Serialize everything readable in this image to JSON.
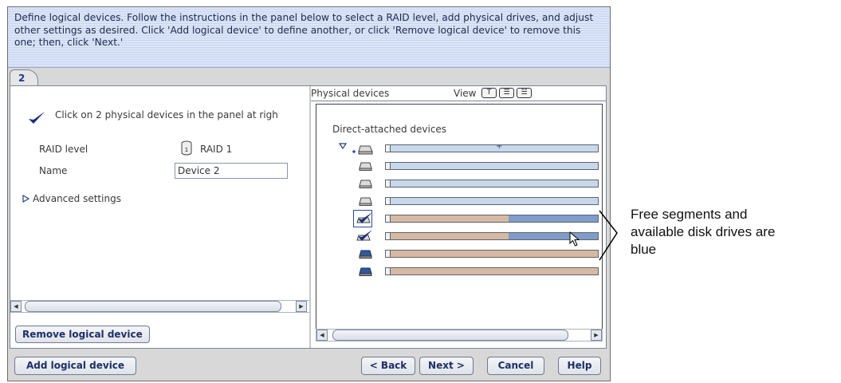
{
  "instructions": "Define logical devices.  Follow the instructions in the panel below to select a RAID level, add physical drives, and adjust other settings as desired.  Click 'Add logical device' to define another, or click 'Remove logical device' to remove this one; then, click 'Next.'",
  "tab": {
    "label": "2"
  },
  "left": {
    "instruction": "Click on 2 physical devices in the panel at righ",
    "raid_label": "RAID level",
    "raid_value": "RAID 1",
    "name_label": "Name",
    "name_value": "Device 2",
    "advanced": "Advanced settings"
  },
  "right": {
    "title": "Physical devices",
    "view_label": "View",
    "view_buttons": [
      "T",
      "list",
      "list-alt"
    ],
    "section_label": "Direct-attached devices"
  },
  "devices": [
    {
      "state": "expanded-free",
      "free_fraction": 1.0
    },
    {
      "state": "free",
      "free_fraction": 1.0
    },
    {
      "state": "free",
      "free_fraction": 1.0
    },
    {
      "state": "free",
      "free_fraction": 1.0
    },
    {
      "state": "selected",
      "used_fraction": 0.58,
      "free_fraction": 0.42
    },
    {
      "state": "selected",
      "used_fraction": 0.58,
      "free_fraction": 0.42
    },
    {
      "state": "used",
      "used_fraction": 1.0
    },
    {
      "state": "used",
      "used_fraction": 1.0
    }
  ],
  "buttons": {
    "remove": "Remove logical device",
    "add": "Add logical device",
    "back": "< Back",
    "next": "Next >",
    "cancel": "Cancel",
    "help": "Help"
  },
  "callout": [
    "Free segments and",
    "available disk drives are",
    "blue"
  ],
  "colors": {
    "free": "#c7d8ea",
    "free_available": "#7f9dc8",
    "used": "#d6b9a3",
    "accent": "#1d2f66"
  }
}
